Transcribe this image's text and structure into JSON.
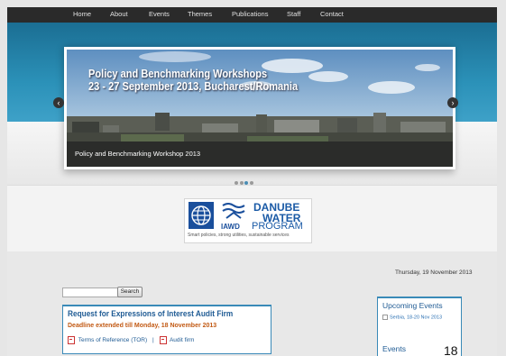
{
  "nav": {
    "items": [
      "Home",
      "About",
      "Events",
      "Themes",
      "Publications",
      "Staff",
      "Contact"
    ]
  },
  "slider": {
    "title_line1": "Policy and Benchmarking Workshops",
    "title_line2": "23 - 27 September 2013, Bucharest/Romania",
    "caption": "Policy and Benchmarking Workshop 2013",
    "prev_icon": "‹",
    "next_icon": "›",
    "slide_count": 4,
    "active_slide": 3
  },
  "logo": {
    "line1": "DANUBE",
    "line2": "WATER",
    "iawd": "IAWD",
    "program": "PROGRAM",
    "tagline": "Smart policies, strong utilities, sustainable services"
  },
  "main": {
    "date": "Thursday, 19 November 2013",
    "search_button": "Search",
    "search_value": "",
    "news": {
      "title": "Request for Expressions of Interest Audit Firm",
      "deadline": "Deadline extended till Monday, 18 November 2013",
      "link1": "Terms of Reference (TOR)",
      "separator": "|",
      "link2": "Audit firm"
    },
    "sidebar": {
      "upcoming_heading": "Upcoming Events",
      "event": "Serbia, 18-20 Nov 2013",
      "events_heading": "Events",
      "day_number": "18"
    }
  },
  "colors": {
    "nav_bg": "#2a2a2a",
    "banner_blue": "#2b91b8",
    "link_blue": "#1f5b94",
    "deadline_orange": "#c25a14"
  }
}
